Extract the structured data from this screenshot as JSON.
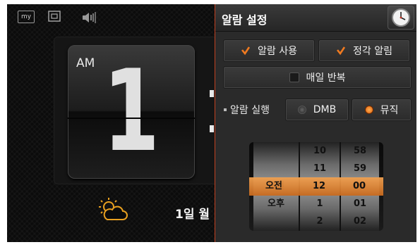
{
  "topbar": {
    "my_label": "my",
    "icons": [
      "my-icon",
      "window-icon",
      "volume-icon"
    ]
  },
  "clock": {
    "ampm": "AM",
    "hour_digit": "1",
    "date_text": "1일 월"
  },
  "weather": {
    "icon": "sun-cloud-icon"
  },
  "panel": {
    "title": "알람 설정",
    "clock_button_icon": "clock-icon",
    "alarm_use": {
      "label": "알람 사용",
      "checked": true
    },
    "hourly_alarm": {
      "label": "정각 알림",
      "checked": true
    },
    "daily_repeat": {
      "label": "매일 반복",
      "checked": false
    },
    "run_label": "알람 실행",
    "run_options": [
      {
        "label": "DMB",
        "selected": false
      },
      {
        "label": "뮤직",
        "selected": true
      }
    ],
    "picker": {
      "ampm": [
        "",
        "",
        "오전",
        "오후",
        ""
      ],
      "hours": [
        "10",
        "11",
        "12",
        "1",
        "2"
      ],
      "minutes": [
        "58",
        "59",
        "00",
        "01",
        "02"
      ],
      "selected": {
        "ampm": "오전",
        "hour": "12",
        "minute": "00"
      }
    }
  },
  "colors": {
    "accent": "#e8701e",
    "check": "#f07a20",
    "panel_bg": "#2a2a2a",
    "screen_bg": "#0b0b0b"
  }
}
